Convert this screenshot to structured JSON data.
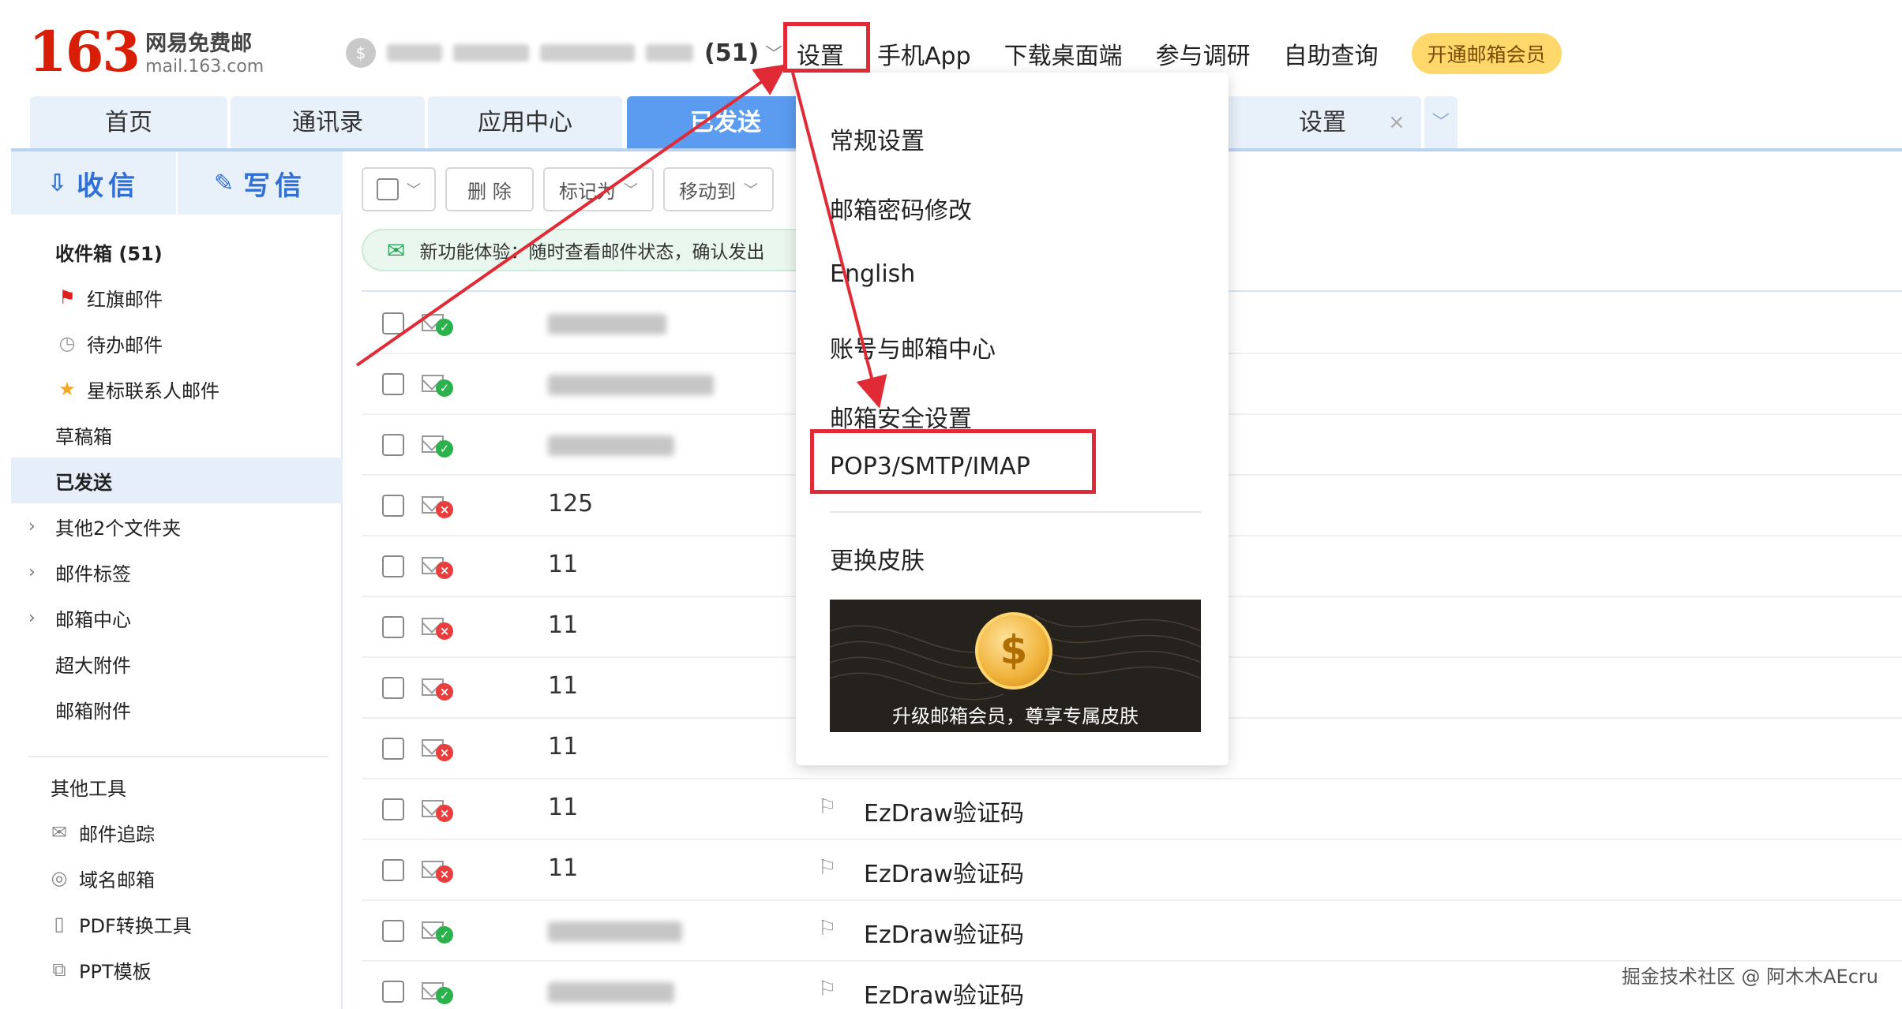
{
  "header": {
    "logo_number": "163",
    "logo_name": "网易免费邮",
    "logo_url": "mail.163.com",
    "account_count": "(51)",
    "nav": [
      {
        "label": "设置"
      },
      {
        "label": "手机App"
      },
      {
        "label": "下载桌面端"
      },
      {
        "label": "参与调研"
      },
      {
        "label": "自助查询"
      }
    ],
    "vip_button": "开通邮箱会员"
  },
  "tabs": [
    {
      "label": "首页"
    },
    {
      "label": "通讯录"
    },
    {
      "label": "应用中心"
    },
    {
      "label": "已发送"
    },
    {
      "label": "设置"
    }
  ],
  "sidebar": {
    "receive": "收信",
    "write": "写信",
    "items": [
      {
        "label": "收件箱 (51)",
        "icon": "none"
      },
      {
        "label": "红旗邮件",
        "icon": "red-flag"
      },
      {
        "label": "待办邮件",
        "icon": "clock"
      },
      {
        "label": "星标联系人邮件",
        "icon": "star"
      },
      {
        "label": "草稿箱",
        "icon": "none"
      },
      {
        "label": "已发送",
        "icon": "none"
      },
      {
        "label": "其他2个文件夹",
        "icon": "caret"
      },
      {
        "label": "邮件标签",
        "icon": "caret"
      },
      {
        "label": "邮箱中心",
        "icon": "caret"
      },
      {
        "label": "超大附件",
        "icon": "none"
      },
      {
        "label": "邮箱附件",
        "icon": "none"
      }
    ],
    "tools_title": "其他工具",
    "tools": [
      {
        "label": "邮件追踪",
        "icon": "mail-track"
      },
      {
        "label": "域名邮箱",
        "icon": "globe"
      },
      {
        "label": "PDF转换工具",
        "icon": "pdf"
      },
      {
        "label": "PPT模板",
        "icon": "ppt"
      }
    ]
  },
  "toolbar": {
    "delete": "删 除",
    "mark": "标记为",
    "move": "移动到"
  },
  "notice": {
    "text": "新功能体验：随时查看邮件状态，确认发出"
  },
  "mail_list": [
    {
      "recipient": "",
      "status": "ok",
      "subject": ""
    },
    {
      "recipient": "",
      "status": "ok",
      "subject": ""
    },
    {
      "recipient": "",
      "status": "ok",
      "subject": ""
    },
    {
      "recipient": "125",
      "status": "fail",
      "subject": ""
    },
    {
      "recipient": "11",
      "status": "fail",
      "subject": ""
    },
    {
      "recipient": "11",
      "status": "fail",
      "subject": ""
    },
    {
      "recipient": "11",
      "status": "fail",
      "subject": ""
    },
    {
      "recipient": "11",
      "status": "fail",
      "subject": ""
    },
    {
      "recipient": "11",
      "status": "fail",
      "subject": "EzDraw验证码"
    },
    {
      "recipient": "11",
      "status": "fail",
      "subject": "EzDraw验证码"
    },
    {
      "recipient": "",
      "status": "ok",
      "subject": "EzDraw验证码"
    },
    {
      "recipient": "",
      "status": "ok",
      "subject": "EzDraw验证码"
    }
  ],
  "dropdown": {
    "items": [
      {
        "label": "常规设置"
      },
      {
        "label": "邮箱密码修改"
      },
      {
        "label": "English"
      },
      {
        "label": "账号与邮箱中心"
      },
      {
        "label": "邮箱安全设置"
      },
      {
        "label": "POP3/SMTP/IMAP"
      },
      {
        "label": "更换皮肤"
      }
    ],
    "banner_text": "升级邮箱会员，尊享专属皮肤"
  },
  "watermark": "掘金技术社区 @ 阿木木AEcru",
  "colors": {
    "brand_red": "#d81e06",
    "accent_blue": "#5b9bf0",
    "annotation_red": "#e02b36",
    "vip_yellow": "#ffd86b"
  }
}
